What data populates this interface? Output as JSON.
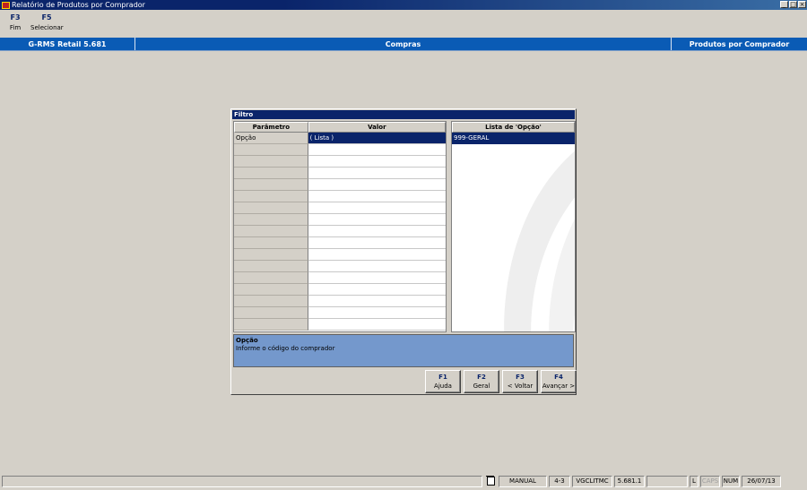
{
  "window": {
    "title": "Relatório de Produtos por Comprador",
    "controls": [
      "_",
      "□",
      "×"
    ]
  },
  "toolbar": [
    {
      "key": "F3",
      "label": "Fim"
    },
    {
      "key": "F5",
      "label": "Selecionar"
    }
  ],
  "header_band": {
    "product": "G-RMS Retail 5.681",
    "module": "Compras",
    "screen": "Produtos por Comprador"
  },
  "dialog": {
    "title": "Filtro",
    "columns": {
      "param": "Parâmetro",
      "value": "Valor"
    },
    "rows": [
      {
        "param": "Opção",
        "value": "( Lista )"
      }
    ],
    "list": {
      "header": "Lista de 'Opção'",
      "items": [
        "999-GERAL"
      ]
    },
    "help": {
      "title": "Opção",
      "text": "Informe o código do comprador"
    },
    "buttons": [
      {
        "key": "F1",
        "label": "Ajuda"
      },
      {
        "key": "F2",
        "label": "Geral"
      },
      {
        "key": "F3",
        "label": "< Voltar"
      },
      {
        "key": "F4",
        "label": "Avançar >"
      }
    ]
  },
  "statusbar": {
    "mode": "MANUAL",
    "page": "4-3",
    "program": "VGCLITMC",
    "version": "5.681.1",
    "l": "L",
    "caps": "CAPS",
    "num": "NUM",
    "date": "26/07/13"
  },
  "colors": {
    "titlebar": "#0a246a",
    "band": "#0a5bb5",
    "help_bg": "#7498cc",
    "selection": "#0a246a",
    "face": "#d4d0c8"
  }
}
